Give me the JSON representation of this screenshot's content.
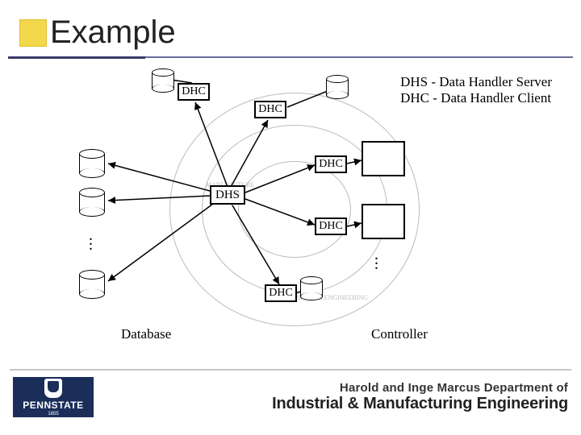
{
  "title": "Example",
  "legend": {
    "line1": "DHS - Data Handler Server",
    "line2": "DHC - Data Handler Client"
  },
  "nodes": {
    "dhs": "DHS",
    "dhc": "DHC"
  },
  "captions": {
    "database": "Database",
    "controller": "Controller"
  },
  "footer": {
    "logo_text": "PENNSTATE",
    "logo_year": "1855",
    "dept_top": "Harold and Inge Marcus Department of",
    "dept_bot": "Industrial & Manufacturing Engineering"
  }
}
